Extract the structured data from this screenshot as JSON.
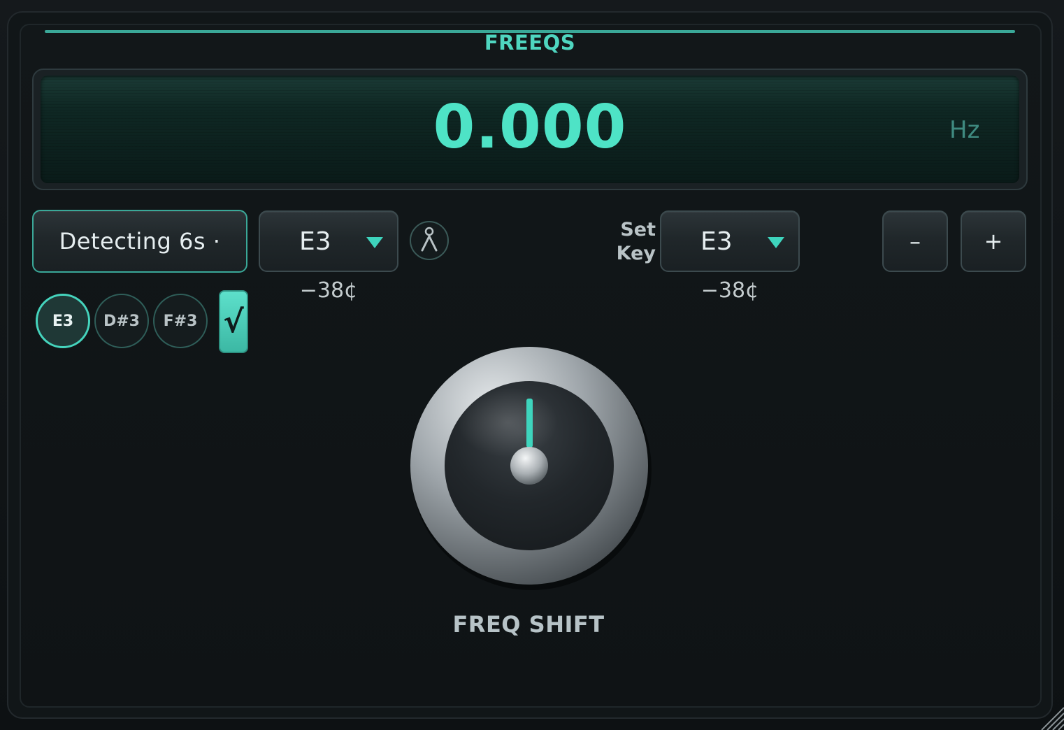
{
  "app": {
    "title": "FREEQS"
  },
  "display": {
    "value": "0.000",
    "unit": "Hz"
  },
  "detect": {
    "label": "Detecting 6s ·"
  },
  "detected_note": {
    "value": "E3",
    "cents": "−38¢"
  },
  "set_key": {
    "label_line1": "Set",
    "label_line2": "Key",
    "value": "E3",
    "cents": "−38¢"
  },
  "stepper": {
    "minus_label": "–",
    "plus_label": "+"
  },
  "note_candidates": [
    {
      "label": "E3",
      "active": true
    },
    {
      "label": "D#3",
      "active": false
    },
    {
      "label": "F#3",
      "active": false
    }
  ],
  "confirm": {
    "label": "√",
    "checked": true
  },
  "knob": {
    "label": "FREQ SHIFT",
    "value_fraction": 0.5
  },
  "colors": {
    "accent": "#4fd6c0",
    "display_text": "#4ee3c6",
    "background": "#111618"
  },
  "icons": {
    "person": "person-icon",
    "caret": "caret-down-icon",
    "check": "checkmark-icon"
  }
}
